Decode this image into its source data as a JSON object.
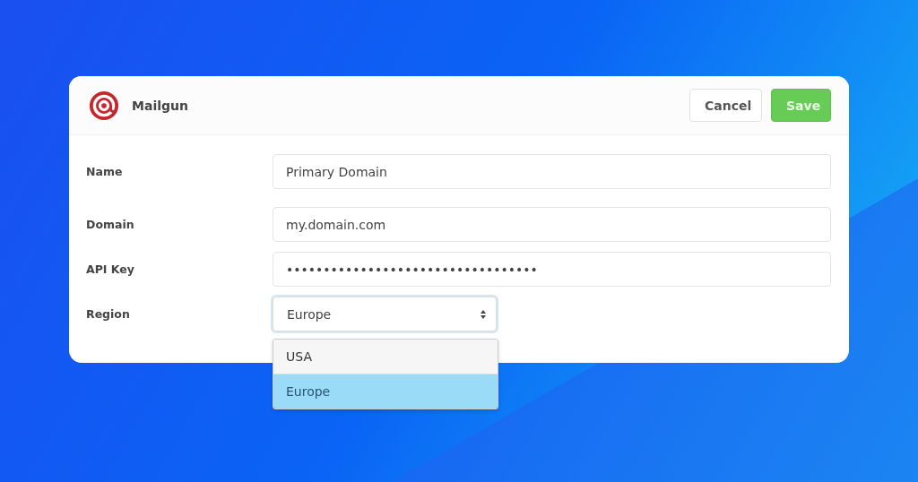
{
  "header": {
    "title": "Mailgun"
  },
  "buttons": [
    {
      "label": "Cancel",
      "kind": "secondary"
    },
    {
      "label": "Save",
      "kind": "primary"
    }
  ],
  "fields": [
    {
      "label": "Name",
      "kind": "text",
      "value": "Primary Domain"
    },
    {
      "label": "Domain",
      "kind": "text",
      "value": "my.domain.com"
    },
    {
      "label": "API Key",
      "kind": "text",
      "value": "••••••••••••••••••••••••••••••••••"
    },
    {
      "label": "Region",
      "kind": "select",
      "value": "Europe",
      "expanded": true,
      "options": [
        {
          "label": "USA",
          "selected": false
        },
        {
          "label": "Europe",
          "selected": true
        }
      ]
    }
  ]
}
